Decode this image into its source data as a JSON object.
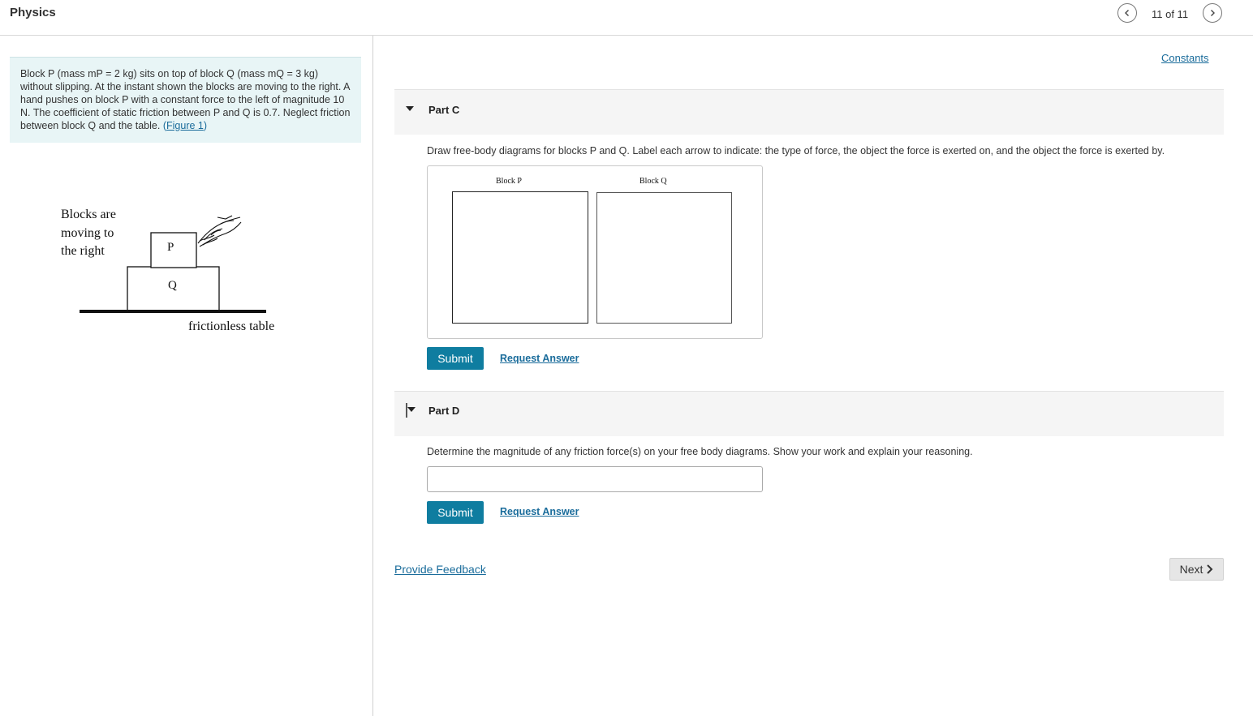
{
  "header": {
    "title": "Physics",
    "page_count": "11 of 11",
    "prev_icon": "chevron-left-icon",
    "next_icon": "chevron-right-icon"
  },
  "problem": {
    "text": "Block P (mass mP = 2 kg) sits on top of block Q (mass mQ = 3 kg) without slipping. At the instant shown the blocks are moving to the right. A hand pushes on block P with a constant force to the left of magnitude 10 N. The coefficient of static friction between P and Q is 0.7. Neglect friction between block Q and the table.",
    "figure_link_prefix": "(",
    "figure_link": "Figure 1",
    "figure_link_suffix": ")"
  },
  "figure": {
    "motion_line1": "Blocks are",
    "motion_line2": "moving to",
    "motion_line3": "the right",
    "block_p": "P",
    "block_q": "Q",
    "table_label": "frictionless table"
  },
  "constants_link": "Constants",
  "part_c": {
    "label": "Part C",
    "instructions": "Draw free-body diagrams for blocks P and Q. Label each arrow to indicate: the type of force, the object the force is exerted on, and the object the force is exerted by.",
    "box_p_label": "Block P",
    "box_q_label": "Block Q",
    "submit": "Submit",
    "request_answer": "Request Answer"
  },
  "part_d": {
    "label": "Part D",
    "instructions": "Determine the magnitude of any friction force(s) on your free body diagrams. Show your work and explain your reasoning.",
    "input_value": "",
    "submit": "Submit",
    "request_answer": "Request Answer"
  },
  "footer": {
    "feedback": "Provide Feedback",
    "next": "Next"
  },
  "colors": {
    "accent": "#0f7da0",
    "link": "#1a6c9b",
    "problem_bg": "#e8f5f6"
  }
}
